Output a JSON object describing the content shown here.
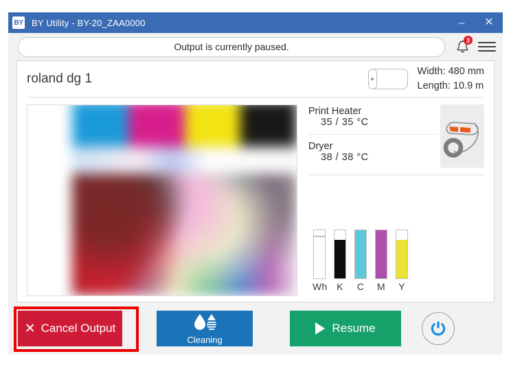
{
  "window": {
    "app_icon_text": "BY",
    "title": "BY Utility - BY-20_ZAA0000",
    "minimize_label": "–",
    "close_label": "✕"
  },
  "status": {
    "message": "Output is currently paused.",
    "notification_count": "3",
    "bell_icon": "bell-icon",
    "menu_icon": "hamburger-menu-icon"
  },
  "printer": {
    "name": "roland dg 1",
    "media": {
      "width": "Width: 480 mm",
      "length": "Length: 10.9 m",
      "roll_icon": "media-roll-icon"
    }
  },
  "temperatures": [
    {
      "label": "Print Heater",
      "value": "35 / 35 °C"
    },
    {
      "label": "Dryer",
      "value": "38 / 38 °C"
    }
  ],
  "printer_diagram_icon": "printer-cross-section-icon",
  "ink": [
    {
      "name": "Wh",
      "level": 88,
      "color": "#ffffff"
    },
    {
      "name": "K",
      "level": 80,
      "color": "#0d0d0d"
    },
    {
      "name": "C",
      "level": 100,
      "color": "#5cc8d8"
    },
    {
      "name": "M",
      "level": 100,
      "color": "#ae4fab"
    },
    {
      "name": "Y",
      "level": 80,
      "color": "#eae234"
    }
  ],
  "buttons": {
    "cancel": {
      "label": "Cancel Output",
      "icon": "close-x-icon",
      "color": "#ce1c38"
    },
    "cleaning": {
      "label": "Cleaning",
      "icon": "ink-droplet-icon",
      "color": "#1b74b8"
    },
    "resume": {
      "label": "Resume",
      "icon": "play-icon",
      "color": "#16a06a"
    },
    "power": {
      "icon": "power-icon",
      "color": "#1b8fe0"
    }
  },
  "highlight": {
    "color": "#ee0000"
  },
  "preview": {
    "color_bands": [
      "#1a9ad8",
      "#d81e8c",
      "#f2e312",
      "#181818"
    ]
  }
}
